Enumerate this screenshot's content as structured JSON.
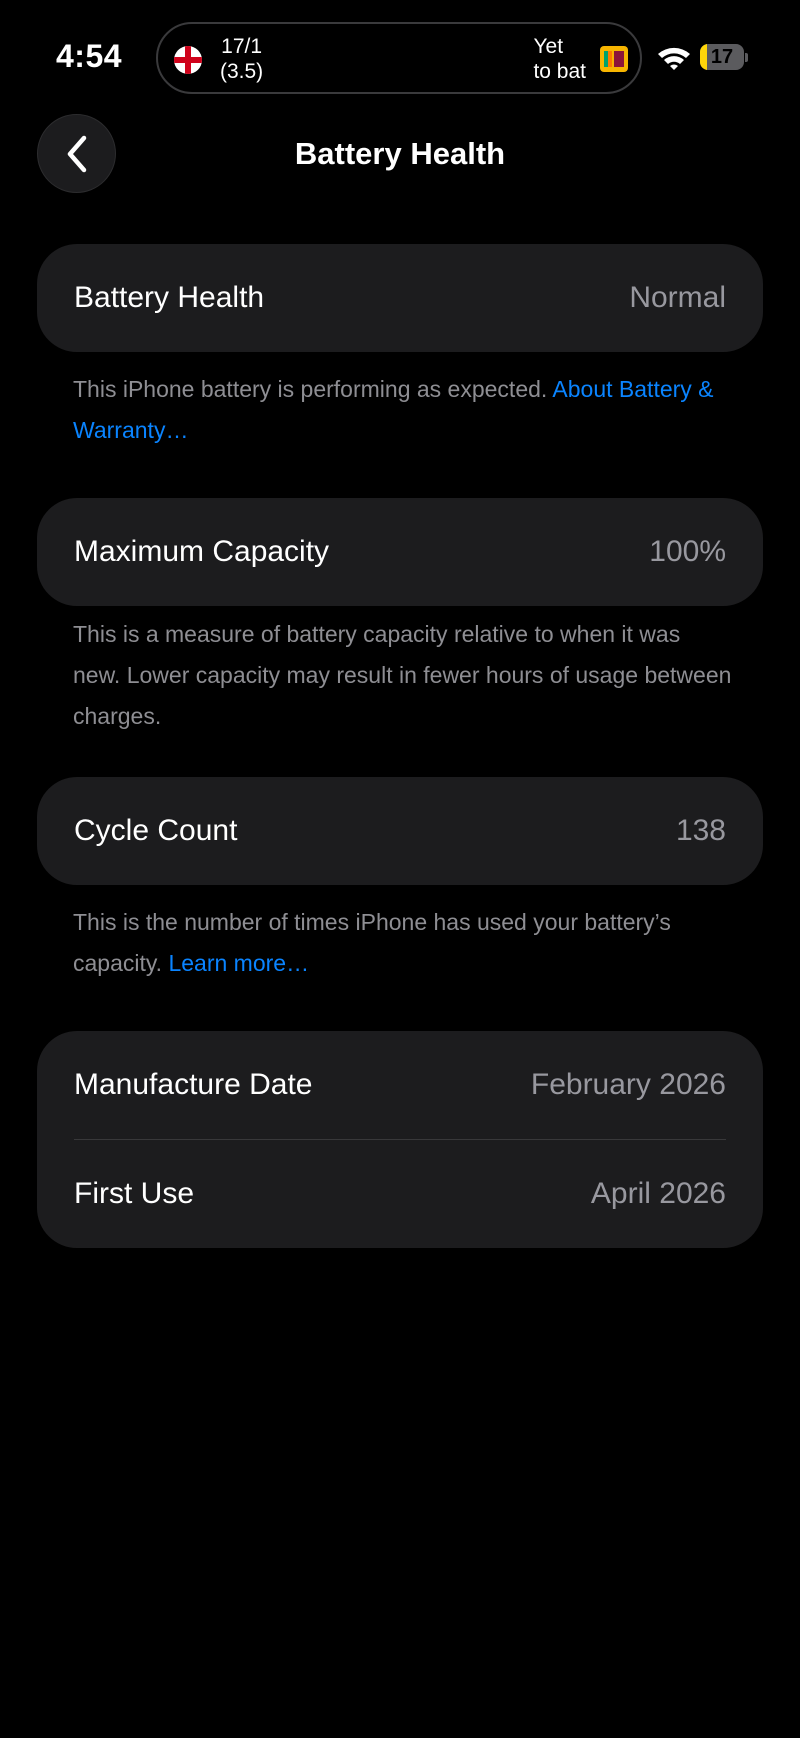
{
  "status_bar": {
    "time": "4:54",
    "live_activity": {
      "team1_score": "17/1",
      "team1_overs": "(3.5)",
      "team2_status_line1": "Yet",
      "team2_status_line2": "to bat"
    },
    "battery_level": "17",
    "battery_fraction": 0.17
  },
  "nav": {
    "back_icon": "chevron-left-icon",
    "title": "Battery Health"
  },
  "sections": {
    "health": {
      "label": "Battery Health",
      "value": "Normal",
      "footnote": "This iPhone battery is performing as expected.",
      "footnote_link": "About Battery & Warranty…"
    },
    "capacity": {
      "label": "Maximum Capacity",
      "value": "100%",
      "footnote": "This is a measure of battery capacity relative to when it was new. Lower capacity may result in fewer hours of usage between charges."
    },
    "cycles": {
      "label": "Cycle Count",
      "value": "138",
      "footnote": "This is the number of times iPhone has used your battery’s capacity.",
      "footnote_link": "Learn more…"
    },
    "dates": {
      "manufacture_label": "Manufacture Date",
      "manufacture_value": "February 2026",
      "first_use_label": "First Use",
      "first_use_value": "April 2026"
    }
  },
  "colors": {
    "background": "#000000",
    "card": "#1c1c1e",
    "link": "#0a84ff",
    "battery_fill": "#ffd60a"
  }
}
